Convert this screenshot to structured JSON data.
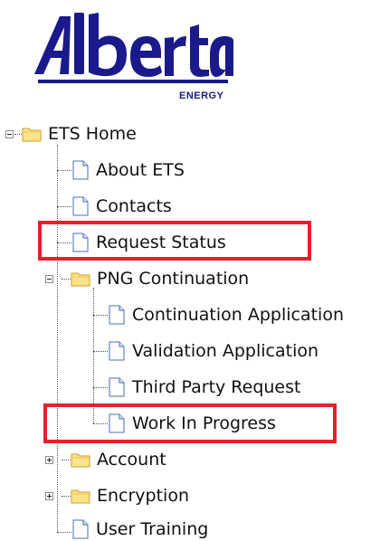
{
  "logo": {
    "wordmark": "Alberta",
    "sublabel": "ENERGY",
    "color": "#1a1a8c"
  },
  "tree": {
    "root": {
      "label": "ETS Home",
      "icon": "folder-icon",
      "expanded": true
    },
    "items": [
      {
        "label": "About ETS",
        "icon": "page-icon"
      },
      {
        "label": "Contacts",
        "icon": "page-icon"
      },
      {
        "label": "Request Status",
        "icon": "page-icon",
        "highlighted": true
      },
      {
        "label": "PNG Continuation",
        "icon": "folder-icon",
        "expanded": true,
        "children": [
          {
            "label": "Continuation Application",
            "icon": "page-icon"
          },
          {
            "label": "Validation Application",
            "icon": "page-icon"
          },
          {
            "label": "Third Party Request",
            "icon": "page-icon"
          },
          {
            "label": "Work In Progress",
            "icon": "page-icon",
            "highlighted": true
          }
        ]
      },
      {
        "label": "Account",
        "icon": "folder-icon",
        "expanded": false
      },
      {
        "label": "Encryption",
        "icon": "folder-icon",
        "expanded": false
      },
      {
        "label": "User Training",
        "icon": "page-icon"
      }
    ]
  },
  "colors": {
    "highlight_border": "#e8202a",
    "folder_fill": "#fbe38d",
    "folder_stroke": "#c9a227",
    "page_stroke": "#4a6fb5"
  }
}
